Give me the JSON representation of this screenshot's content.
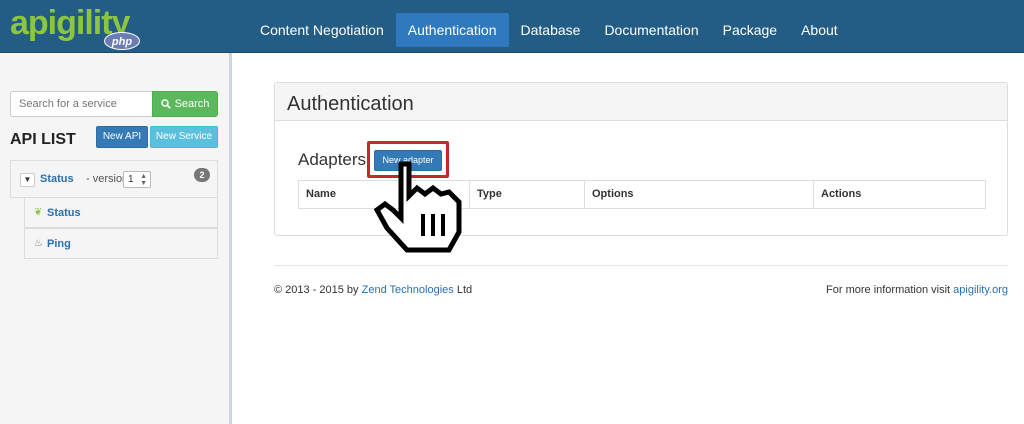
{
  "brand": {
    "logo_text": "apigility",
    "badge_text": "php",
    "logo_color": "#8cc63e"
  },
  "nav": {
    "items": [
      {
        "label": "Content Negotiation"
      },
      {
        "label": "Authentication",
        "active": true
      },
      {
        "label": "Database"
      },
      {
        "label": "Documentation"
      },
      {
        "label": "Package"
      },
      {
        "label": "About"
      }
    ],
    "background": "#235d85",
    "active_color": "#2f7abf"
  },
  "sidebar": {
    "search": {
      "placeholder": "Search for a service",
      "button_label": "Search",
      "button_icon": "search-icon"
    },
    "title": "API LIST",
    "new_api_label": "New API",
    "new_service_label": "New Service",
    "api": {
      "name": "Status",
      "version_label": "- version",
      "version_value": "1",
      "service_count": "2",
      "services": [
        {
          "label": "Status",
          "icon": "leaf-icon"
        },
        {
          "label": "Ping",
          "icon": "fire-icon"
        }
      ]
    }
  },
  "main": {
    "heading": "Authentication",
    "adapters_title": "Adapters",
    "new_adapter_label": "New adapter",
    "table": {
      "columns": [
        "Name",
        "Type",
        "Options",
        "Actions"
      ]
    }
  },
  "footer": {
    "copyright_prefix": "© 2013 - 2015 by ",
    "company_link": "Zend Technologies",
    "copyright_suffix": " Ltd",
    "info_prefix": "For more information visit ",
    "info_link": "apigility.org"
  },
  "colors": {
    "primary": "#337ab7",
    "success": "#5cb85c",
    "info": "#5bc0de",
    "highlight": "#c9252c"
  }
}
